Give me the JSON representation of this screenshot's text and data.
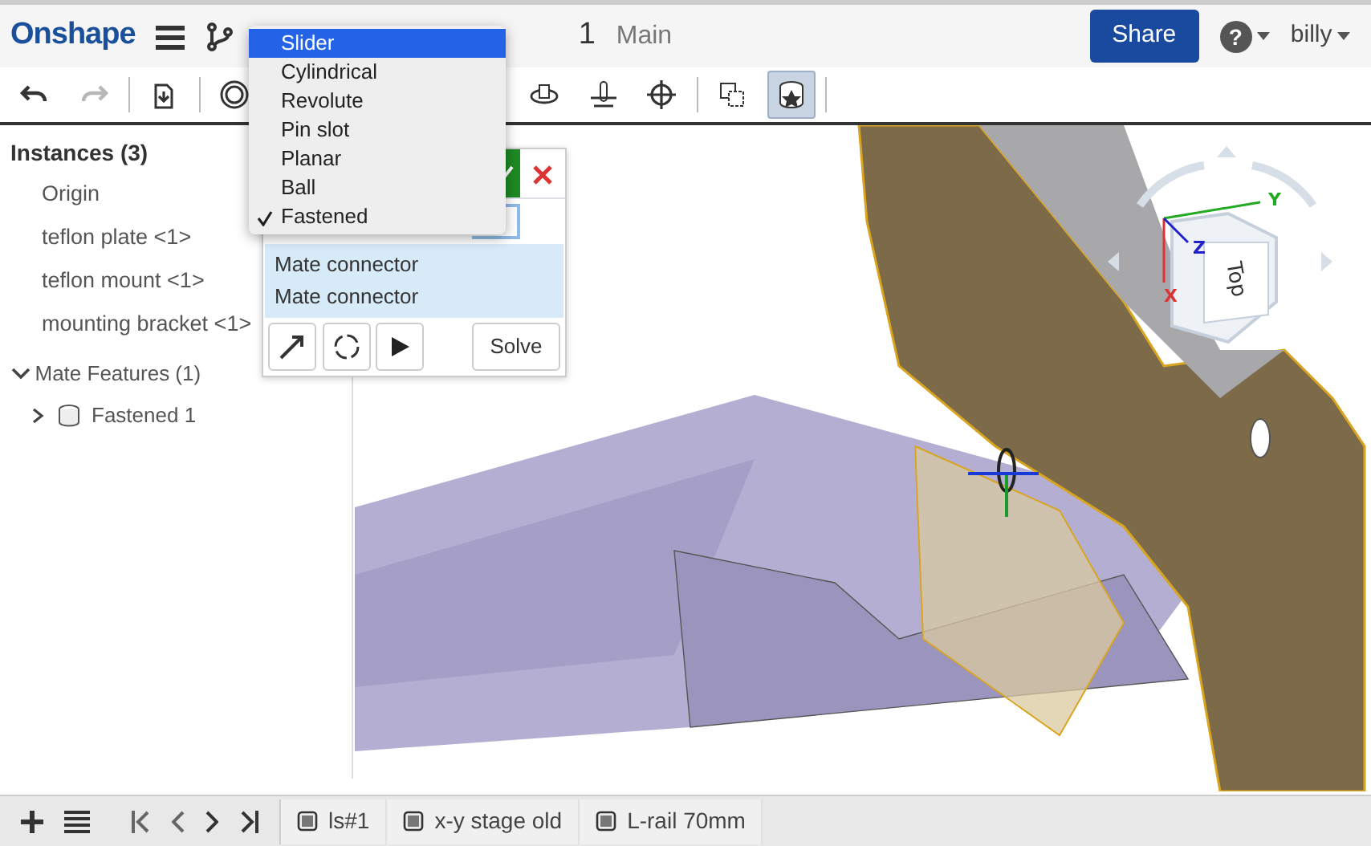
{
  "header": {
    "logo": "Onshape",
    "document_title": "1",
    "branch": "Main",
    "share_button": "Share",
    "help_button": "?",
    "user": "billy"
  },
  "toolbar": [
    {
      "kind": "undo",
      "disabled": false,
      "selected": false
    },
    {
      "kind": "redo",
      "disabled": true,
      "selected": false
    },
    {
      "kind": "insert",
      "disabled": false,
      "selected": false
    },
    {
      "kind": "mate",
      "disabled": false,
      "selected": false
    },
    {
      "kind": "rotate",
      "disabled": false,
      "selected": false
    },
    {
      "kind": "slide",
      "disabled": false,
      "selected": false
    },
    {
      "kind": "move",
      "disabled": false,
      "selected": false
    },
    {
      "kind": "group",
      "disabled": false,
      "selected": false
    },
    {
      "kind": "mate_feature",
      "disabled": false,
      "selected": true
    }
  ],
  "instances": {
    "heading": "Instances (3)",
    "items": [
      "Origin",
      "teflon plate <1>",
      "teflon mount <1>",
      "mounting bracket <1>"
    ],
    "features": {
      "label": "Mate Features (1)",
      "expanded": true,
      "children": [
        {
          "label": "Fastened 1",
          "expanded": false
        }
      ]
    }
  },
  "mate_dialog": {
    "type_options": [
      {
        "label": "Slider",
        "selected": true,
        "checked": false
      },
      {
        "label": "Cylindrical",
        "selected": false,
        "checked": false
      },
      {
        "label": "Revolute",
        "selected": false,
        "checked": false
      },
      {
        "label": "Pin slot",
        "selected": false,
        "checked": false
      },
      {
        "label": "Planar",
        "selected": false,
        "checked": false
      },
      {
        "label": "Ball",
        "selected": false,
        "checked": false
      },
      {
        "label": "Fastened",
        "selected": false,
        "checked": true
      }
    ],
    "connectors": [
      "Mate connector",
      "Mate connector"
    ],
    "solve_button": "Solve"
  },
  "view_cube": {
    "face": "Top",
    "axes": [
      "X",
      "Y",
      "Z"
    ]
  },
  "tabs_bar": {
    "tabs": [
      "ls#1",
      "x-y stage old",
      "L-rail 70mm"
    ]
  }
}
